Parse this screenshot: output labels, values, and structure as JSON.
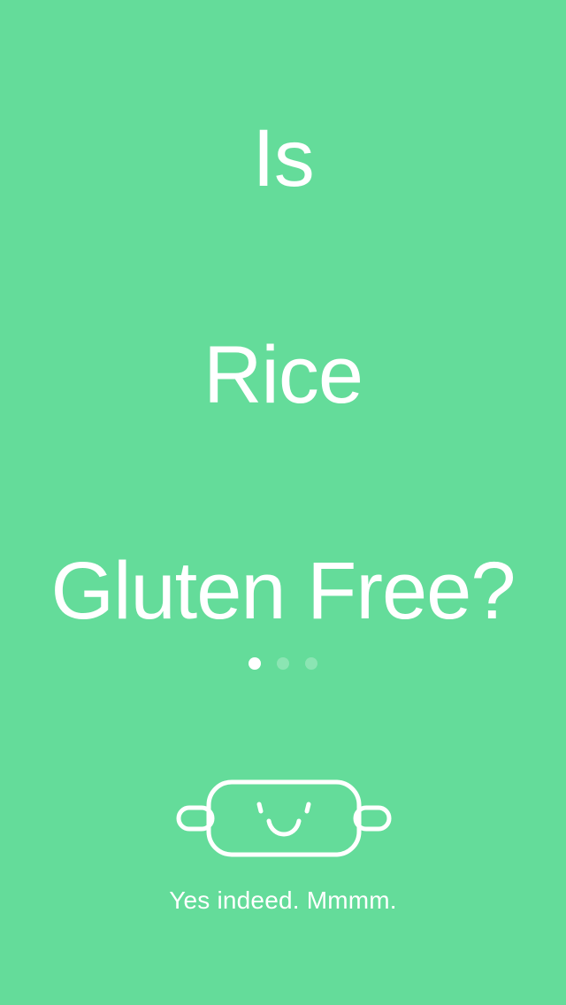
{
  "question": {
    "line1": "Is",
    "line2": "Rice",
    "line3": "Gluten Free?"
  },
  "pager": {
    "total": 3,
    "current": 1
  },
  "mascot": {
    "icon": "rolling-pin-smiley-icon"
  },
  "answer": {
    "caption": "Yes indeed. Mmmm."
  },
  "colors": {
    "background": "#64DC9A",
    "foreground": "#FFFFFF"
  }
}
